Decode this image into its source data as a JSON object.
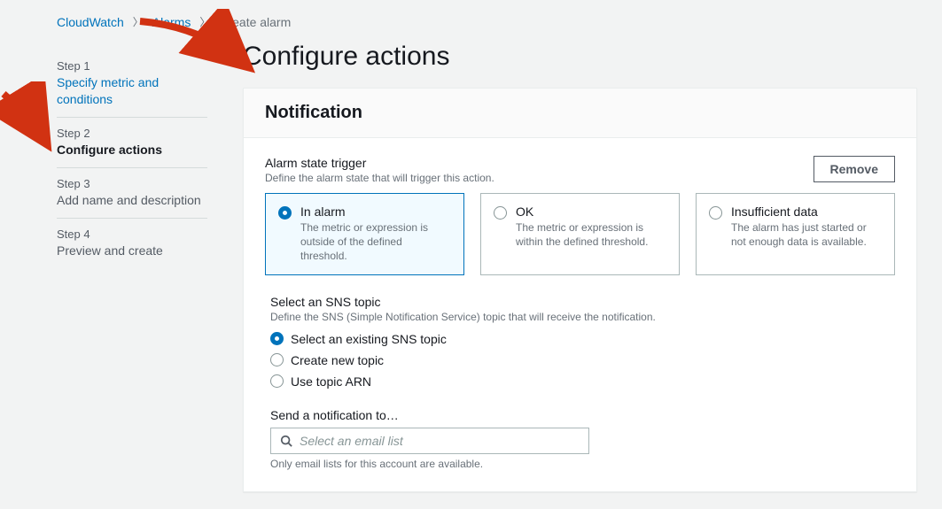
{
  "breadcrumb": {
    "items": [
      "CloudWatch",
      "Alarms",
      "Create alarm"
    ]
  },
  "wizard": {
    "steps": [
      {
        "num": "Step 1",
        "label": "Specify metric and conditions"
      },
      {
        "num": "Step 2",
        "label": "Configure actions"
      },
      {
        "num": "Step 3",
        "label": "Add name and description"
      },
      {
        "num": "Step 4",
        "label": "Preview and create"
      }
    ]
  },
  "page": {
    "title": "Configure actions"
  },
  "notification": {
    "heading": "Notification",
    "trigger": {
      "title": "Alarm state trigger",
      "desc": "Define the alarm state that will trigger this action.",
      "remove": "Remove",
      "options": [
        {
          "title": "In alarm",
          "desc": "The metric or expression is outside of the defined threshold."
        },
        {
          "title": "OK",
          "desc": "The metric or expression is within the defined threshold."
        },
        {
          "title": "Insufficient data",
          "desc": "The alarm has just started or not enough data is available."
        }
      ]
    },
    "sns": {
      "title": "Select an SNS topic",
      "desc": "Define the SNS (Simple Notification Service) topic that will receive the notification.",
      "options": [
        "Select an existing SNS topic",
        "Create new topic",
        "Use topic ARN"
      ]
    },
    "sendto": {
      "label": "Send a notification to…",
      "placeholder": "Select an email list",
      "hint": "Only email lists for this account are available."
    }
  }
}
